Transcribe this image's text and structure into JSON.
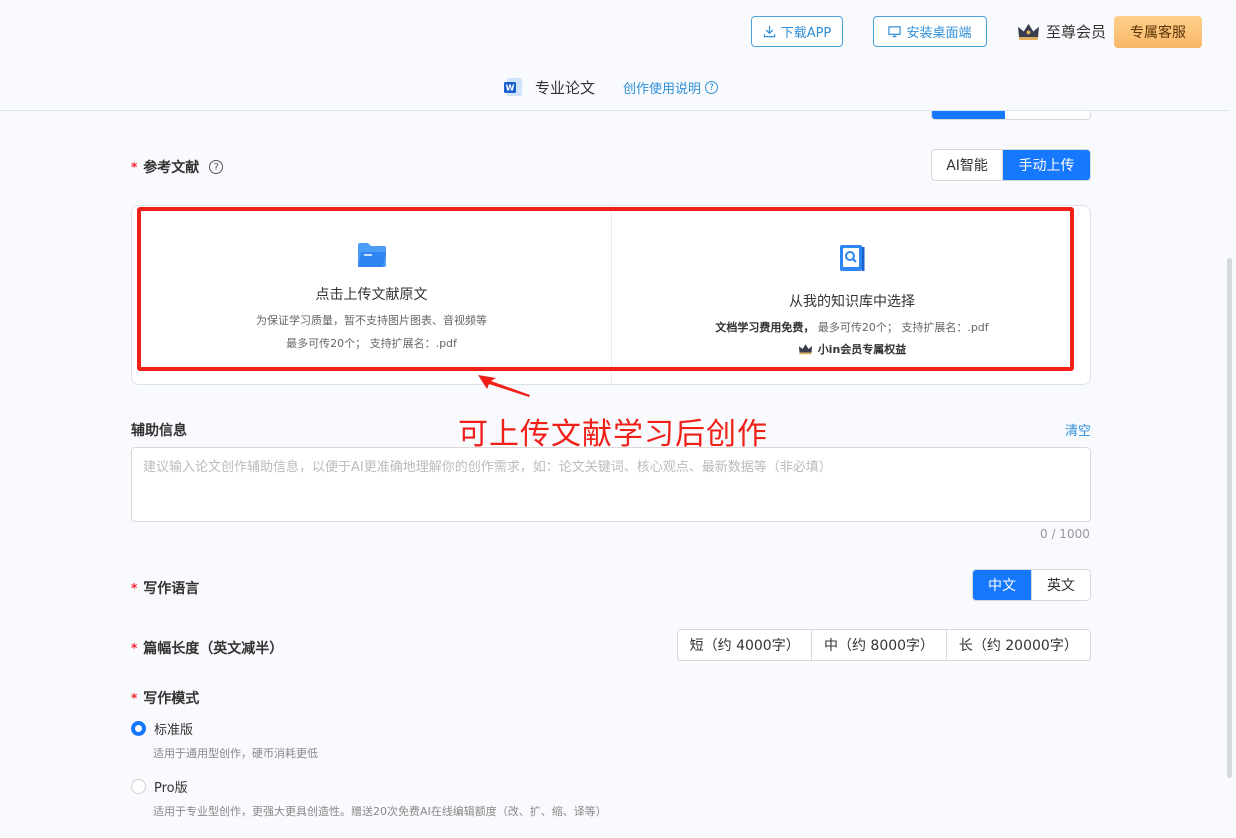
{
  "header": {
    "download_app": "下载APP",
    "install_desktop": "安装桌面端",
    "member_label": "至尊会员",
    "exclusive_service": "专属客服",
    "doc_type": "专业论文",
    "guide_link": "创作使用说明"
  },
  "references": {
    "label": "参考文献",
    "toggle": [
      "AI智能",
      "手动上传"
    ],
    "active_toggle": "手动上传",
    "upload": {
      "title": "点击上传文献原文",
      "line1": "为保证学习质量，暂不支持图片图表、音视频等",
      "line2": "最多可传20个；  支持扩展名：.pdf"
    },
    "knowledge": {
      "title": "从我的知识库中选择",
      "line1_bold": "文档学习费用免费，",
      "line1_rest": "  最多可传20个；  支持扩展名：.pdf",
      "vip": "小in会员专属权益"
    }
  },
  "annotation": "可上传文献学习后创作",
  "aux_info": {
    "label": "辅助信息",
    "clear": "清空",
    "placeholder": "建议输入论文创作辅助信息，以便于AI更准确地理解你的创作需求，如：论文关键词、核心观点、最新数据等（非必填）",
    "counter": "0 / 1000"
  },
  "language": {
    "label": "写作语言",
    "options": [
      "中文",
      "英文"
    ],
    "active": "中文"
  },
  "length": {
    "label": "篇幅长度（英文减半）",
    "options": [
      "短（约 4000字）",
      "中（约 8000字）",
      "长（约 20000字）"
    ]
  },
  "mode": {
    "label": "写作模式",
    "options": [
      {
        "name": "标准版",
        "desc": "适用于通用型创作，硬币消耗更低",
        "checked": true
      },
      {
        "name": "Pro版",
        "desc": "适用于专业型创作，更强大更具创造性。赠送20次免费AI在线编辑额度（改、扩、缩、译等）",
        "checked": false
      }
    ]
  },
  "colors": {
    "accent": "#1677ff",
    "link": "#2f8fd8",
    "annotation": "#f01f17",
    "vip_button": "#f7b867"
  }
}
